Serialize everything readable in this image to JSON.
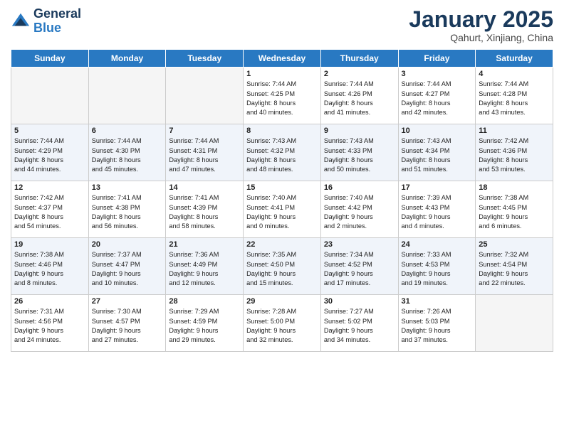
{
  "header": {
    "logo_line1": "General",
    "logo_line2": "Blue",
    "month": "January 2025",
    "location": "Qahurt, Xinjiang, China"
  },
  "days_of_week": [
    "Sunday",
    "Monday",
    "Tuesday",
    "Wednesday",
    "Thursday",
    "Friday",
    "Saturday"
  ],
  "weeks": [
    [
      {
        "num": "",
        "text": ""
      },
      {
        "num": "",
        "text": ""
      },
      {
        "num": "",
        "text": ""
      },
      {
        "num": "1",
        "text": "Sunrise: 7:44 AM\nSunset: 4:25 PM\nDaylight: 8 hours\nand 40 minutes."
      },
      {
        "num": "2",
        "text": "Sunrise: 7:44 AM\nSunset: 4:26 PM\nDaylight: 8 hours\nand 41 minutes."
      },
      {
        "num": "3",
        "text": "Sunrise: 7:44 AM\nSunset: 4:27 PM\nDaylight: 8 hours\nand 42 minutes."
      },
      {
        "num": "4",
        "text": "Sunrise: 7:44 AM\nSunset: 4:28 PM\nDaylight: 8 hours\nand 43 minutes."
      }
    ],
    [
      {
        "num": "5",
        "text": "Sunrise: 7:44 AM\nSunset: 4:29 PM\nDaylight: 8 hours\nand 44 minutes."
      },
      {
        "num": "6",
        "text": "Sunrise: 7:44 AM\nSunset: 4:30 PM\nDaylight: 8 hours\nand 45 minutes."
      },
      {
        "num": "7",
        "text": "Sunrise: 7:44 AM\nSunset: 4:31 PM\nDaylight: 8 hours\nand 47 minutes."
      },
      {
        "num": "8",
        "text": "Sunrise: 7:43 AM\nSunset: 4:32 PM\nDaylight: 8 hours\nand 48 minutes."
      },
      {
        "num": "9",
        "text": "Sunrise: 7:43 AM\nSunset: 4:33 PM\nDaylight: 8 hours\nand 50 minutes."
      },
      {
        "num": "10",
        "text": "Sunrise: 7:43 AM\nSunset: 4:34 PM\nDaylight: 8 hours\nand 51 minutes."
      },
      {
        "num": "11",
        "text": "Sunrise: 7:42 AM\nSunset: 4:36 PM\nDaylight: 8 hours\nand 53 minutes."
      }
    ],
    [
      {
        "num": "12",
        "text": "Sunrise: 7:42 AM\nSunset: 4:37 PM\nDaylight: 8 hours\nand 54 minutes."
      },
      {
        "num": "13",
        "text": "Sunrise: 7:41 AM\nSunset: 4:38 PM\nDaylight: 8 hours\nand 56 minutes."
      },
      {
        "num": "14",
        "text": "Sunrise: 7:41 AM\nSunset: 4:39 PM\nDaylight: 8 hours\nand 58 minutes."
      },
      {
        "num": "15",
        "text": "Sunrise: 7:40 AM\nSunset: 4:41 PM\nDaylight: 9 hours\nand 0 minutes."
      },
      {
        "num": "16",
        "text": "Sunrise: 7:40 AM\nSunset: 4:42 PM\nDaylight: 9 hours\nand 2 minutes."
      },
      {
        "num": "17",
        "text": "Sunrise: 7:39 AM\nSunset: 4:43 PM\nDaylight: 9 hours\nand 4 minutes."
      },
      {
        "num": "18",
        "text": "Sunrise: 7:38 AM\nSunset: 4:45 PM\nDaylight: 9 hours\nand 6 minutes."
      }
    ],
    [
      {
        "num": "19",
        "text": "Sunrise: 7:38 AM\nSunset: 4:46 PM\nDaylight: 9 hours\nand 8 minutes."
      },
      {
        "num": "20",
        "text": "Sunrise: 7:37 AM\nSunset: 4:47 PM\nDaylight: 9 hours\nand 10 minutes."
      },
      {
        "num": "21",
        "text": "Sunrise: 7:36 AM\nSunset: 4:49 PM\nDaylight: 9 hours\nand 12 minutes."
      },
      {
        "num": "22",
        "text": "Sunrise: 7:35 AM\nSunset: 4:50 PM\nDaylight: 9 hours\nand 15 minutes."
      },
      {
        "num": "23",
        "text": "Sunrise: 7:34 AM\nSunset: 4:52 PM\nDaylight: 9 hours\nand 17 minutes."
      },
      {
        "num": "24",
        "text": "Sunrise: 7:33 AM\nSunset: 4:53 PM\nDaylight: 9 hours\nand 19 minutes."
      },
      {
        "num": "25",
        "text": "Sunrise: 7:32 AM\nSunset: 4:54 PM\nDaylight: 9 hours\nand 22 minutes."
      }
    ],
    [
      {
        "num": "26",
        "text": "Sunrise: 7:31 AM\nSunset: 4:56 PM\nDaylight: 9 hours\nand 24 minutes."
      },
      {
        "num": "27",
        "text": "Sunrise: 7:30 AM\nSunset: 4:57 PM\nDaylight: 9 hours\nand 27 minutes."
      },
      {
        "num": "28",
        "text": "Sunrise: 7:29 AM\nSunset: 4:59 PM\nDaylight: 9 hours\nand 29 minutes."
      },
      {
        "num": "29",
        "text": "Sunrise: 7:28 AM\nSunset: 5:00 PM\nDaylight: 9 hours\nand 32 minutes."
      },
      {
        "num": "30",
        "text": "Sunrise: 7:27 AM\nSunset: 5:02 PM\nDaylight: 9 hours\nand 34 minutes."
      },
      {
        "num": "31",
        "text": "Sunrise: 7:26 AM\nSunset: 5:03 PM\nDaylight: 9 hours\nand 37 minutes."
      },
      {
        "num": "",
        "text": ""
      }
    ]
  ]
}
